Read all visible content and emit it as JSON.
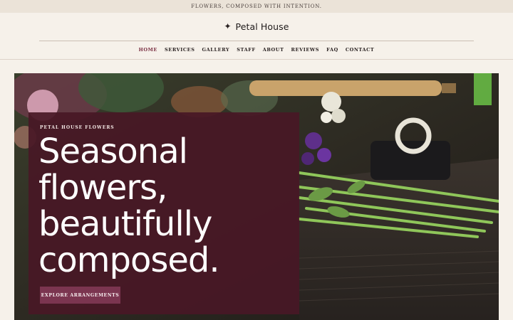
{
  "announcement": "FLOWERS, COMPOSED WITH INTENTION.",
  "brand": {
    "icon": "sparkle-icon",
    "glyph": "✦",
    "name": "Petal House"
  },
  "nav": {
    "items": [
      {
        "label": "HOME",
        "active": true
      },
      {
        "label": "SERVICES"
      },
      {
        "label": "GALLERY"
      },
      {
        "label": "STAFF"
      },
      {
        "label": "ABOUT"
      },
      {
        "label": "REVIEWS"
      },
      {
        "label": "FAQ"
      },
      {
        "label": "CONTACT"
      }
    ]
  },
  "hero": {
    "eyebrow": "PETAL HOUSE FLOWERS",
    "headline": [
      "Seasonal",
      "flowers,",
      "beautifully",
      "composed."
    ],
    "cta_label": "EXPLORE ARRANGEMENTS"
  },
  "colors": {
    "background": "#f6f1ea",
    "announcement_bar": "#ebe3d8",
    "accent": "#7a2f42",
    "panel": "#481826",
    "button": "#7b3550"
  }
}
